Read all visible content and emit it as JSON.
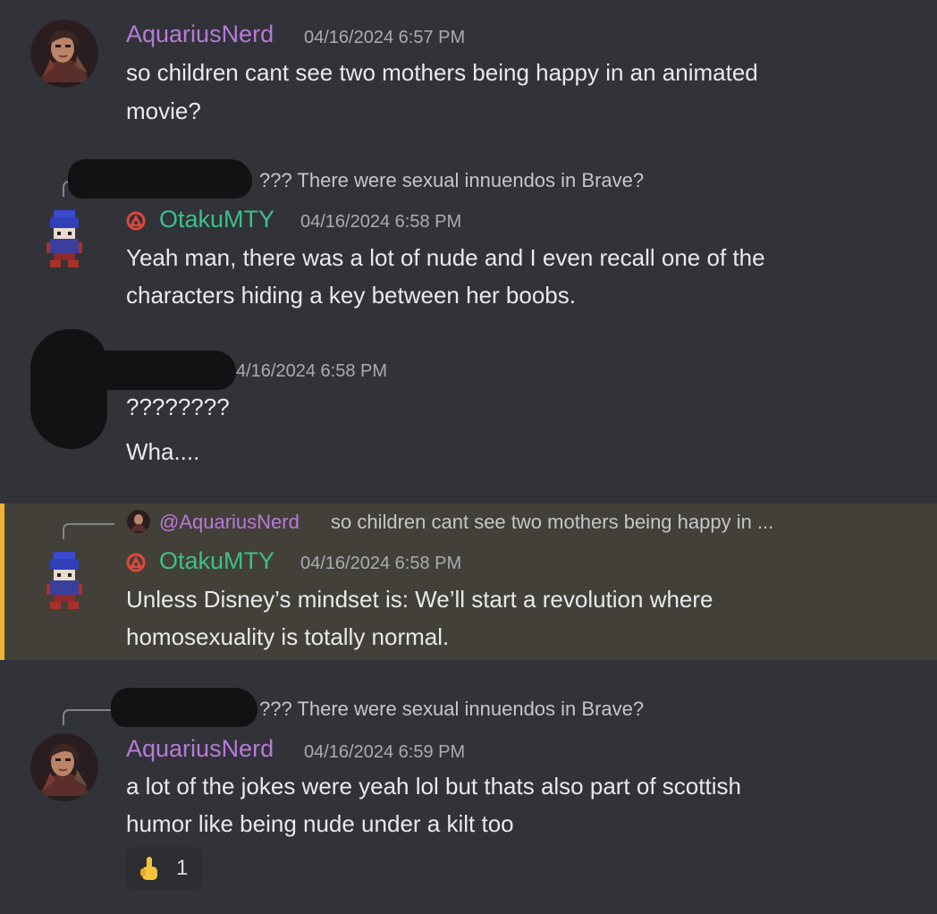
{
  "messages": [
    {
      "username": "AquariusNerd",
      "timestamp": "04/16/2024 6:57 PM",
      "lines": [
        "so children cant see two mothers being happy in an animated",
        "movie?"
      ]
    },
    {
      "reply": "??? There were sexual innuendos in Brave?",
      "username": "OtakuMTY",
      "timestamp": "04/16/2024 6:58 PM",
      "lines": [
        "Yeah man, there was a lot of nude and I even recall one of the",
        "characters hiding a key between her boobs."
      ]
    },
    {
      "timestamp": "4/16/2024 6:58 PM",
      "lines": [
        "????????",
        "Wha...."
      ]
    },
    {
      "reply_mention": "@AquariusNerd",
      "reply": "so children cant see two mothers being happy in ...",
      "username": "OtakuMTY",
      "timestamp": "04/16/2024 6:58 PM",
      "lines": [
        "Unless Disney’s mindset is: We’ll start a revolution where",
        "homosexuality is totally normal."
      ]
    },
    {
      "reply": "??? There were sexual innuendos in Brave?",
      "username": "AquariusNerd",
      "timestamp": "04/16/2024 6:59 PM",
      "lines": [
        "a lot of the jokes were yeah lol but thats also part of scottish",
        "humor like being nude under a kilt too"
      ],
      "reaction": {
        "emoji": "☝",
        "count": "1"
      }
    }
  ],
  "colors": {
    "background": "#313338",
    "highlight": "#434039",
    "highlight_bar": "#f0b232",
    "aquarius_name": "#b77ad8",
    "otaku_name": "#3ebf8a"
  },
  "icons": [
    "avatar-aquariusnerd",
    "avatar-otakumty-pixel",
    "role-badge-icon",
    "point-up-emoji"
  ]
}
